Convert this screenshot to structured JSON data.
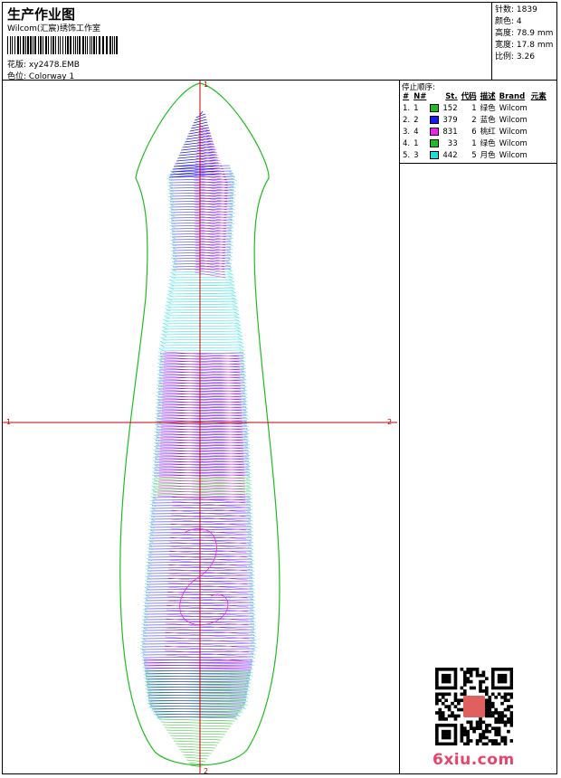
{
  "header": {
    "title": "生产作业图",
    "company": "Wilcom(汇宸)绣饰工作室",
    "design_label": "花版:",
    "design_file": "xy2478.EMB",
    "colorway_label": "色位:",
    "colorway_name": "Colorway 1"
  },
  "stats": {
    "stitches_label": "针数:",
    "stitches": "1839",
    "colors_label": "颜色:",
    "colors": "4",
    "height_label": "高度:",
    "height": "78.9 mm",
    "width_label": "宽度:",
    "width": "17.8 mm",
    "scale_label": "比例:",
    "scale": "3.26"
  },
  "sequence": {
    "title": "停止顺序:",
    "columns": [
      "#",
      "N#",
      "St.",
      "代码",
      "描述",
      "Brand",
      "元素"
    ],
    "rows": [
      {
        "idx": "1.",
        "n": "1",
        "color": "#22bb22",
        "st": "152",
        "code": "1",
        "desc": "绿色",
        "brand": "Wilcom"
      },
      {
        "idx": "2.",
        "n": "2",
        "color": "#1a1aee",
        "st": "379",
        "code": "2",
        "desc": "蓝色",
        "brand": "Wilcom"
      },
      {
        "idx": "3.",
        "n": "4",
        "color": "#ee22ee",
        "st": "831",
        "code": "6",
        "desc": "桃红",
        "brand": "Wilcom"
      },
      {
        "idx": "4.",
        "n": "1",
        "color": "#22bb22",
        "st": "33",
        "code": "1",
        "desc": "绿色",
        "brand": "Wilcom"
      },
      {
        "idx": "5.",
        "n": "3",
        "color": "#22dddd",
        "st": "442",
        "code": "5",
        "desc": "月色",
        "brand": "Wilcom"
      }
    ]
  },
  "axes": {
    "top": "1",
    "bottom": "2",
    "left": "1",
    "right": "2"
  },
  "watermark": "6xiu.com",
  "icons": {
    "qr": "qr-code-icon"
  }
}
